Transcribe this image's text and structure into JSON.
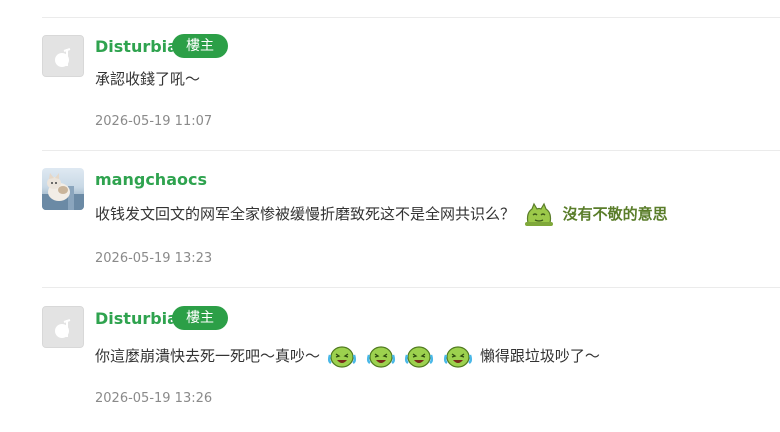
{
  "comments": [
    {
      "username": "Disturbia",
      "badge": "樓主",
      "text": "承認收錢了吼～",
      "timestamp": "2026-05-19 11:07",
      "avatar_icon": "default-avatar-icon"
    },
    {
      "username": "mangchaocs",
      "text": "收钱发文回文的网军全家惨被缓慢折磨致死这不是全网共识么？",
      "sticker_label": "沒有不敬的意思",
      "timestamp": "2026-05-19 13:23",
      "avatar_icon": "cat-avatar"
    },
    {
      "username": "Disturbia",
      "badge": "樓主",
      "text_before": "你這麼崩潰快去死一死吧～真吵～",
      "text_after": "懶得跟垃圾吵了～",
      "timestamp": "2026-05-19 13:26",
      "avatar_icon": "default-avatar-icon",
      "emoji_icon": "laughing-crying-emoji-icon",
      "emoji_count": 4
    }
  ],
  "colors": {
    "username": "#2fa34f",
    "badge_bg": "#2c9f47",
    "divider": "#ebebeb",
    "timestamp": "#8a8a8a",
    "sticker_text": "#5a7d2a"
  }
}
